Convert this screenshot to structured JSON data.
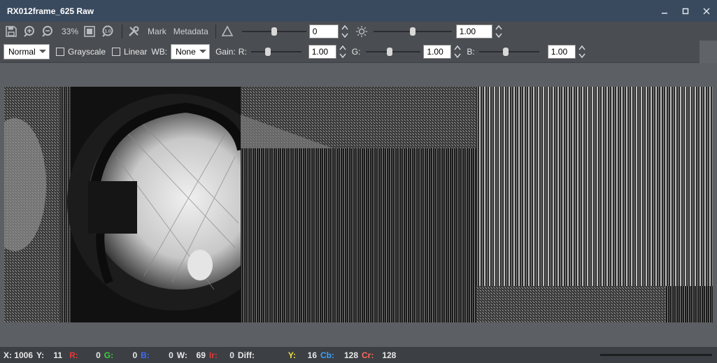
{
  "window": {
    "title": "RX012frame_625 Raw",
    "controls": [
      "minimize-icon",
      "maximize-icon",
      "close-icon"
    ]
  },
  "toolbar": {
    "zoom": "33%",
    "mark_label": "Mark",
    "metadata_label": "Metadata",
    "contrast_value": "0",
    "brightness_value": "1.00",
    "contrast_slider_level": 0.5,
    "brightness_slider_level": 0.5
  },
  "toolbar2": {
    "mode_value": "Normal",
    "grayscale_label": "Grayscale",
    "grayscale_checked": false,
    "linear_label": "Linear",
    "linear_checked": false,
    "wb_label": "WB:",
    "wb_value": "None",
    "gain_label": "Gain:",
    "r_label": "R:",
    "r_value": "1.00",
    "g_label": "G:",
    "g_value": "1.00",
    "b_label": "B:",
    "b_value": "1.00"
  },
  "status": {
    "x_label": "X:",
    "x_value": "1006",
    "y_label": "Y:",
    "y_value": "11",
    "r_label": "R:",
    "r_value": "0",
    "g_label": "G:",
    "g_value": "0",
    "b_label": "B:",
    "b_value": "0",
    "w_label": "W:",
    "w_value": "69",
    "ir_label": "Ir:",
    "ir_value": "0",
    "diff_label": "Diff:",
    "yy_label": "Y:",
    "yy_value": "16",
    "cb_label": "Cb:",
    "cb_value": "128",
    "cr_label": "Cr:",
    "cr_value": "128"
  },
  "colors": {
    "r": "#e23a3a",
    "g": "#39d43a",
    "b": "#3b6bff",
    "y": "#f0e040",
    "cb": "#3aa0ff",
    "cr": "#ff6a5a"
  }
}
